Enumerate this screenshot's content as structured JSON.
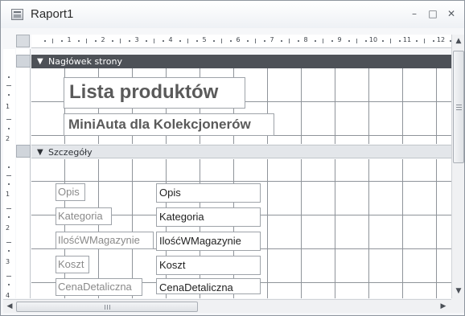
{
  "window": {
    "title": "Raport1",
    "icon": "report-icon",
    "controls": [
      "minimize-icon",
      "restore-icon",
      "close-icon"
    ]
  },
  "ruler": {
    "numbers": [
      "1",
      "2",
      "3",
      "4",
      "5",
      "6",
      "7",
      "8",
      "9",
      "10",
      "11",
      "12"
    ],
    "vertical_numbers": [
      "1",
      "2",
      "1",
      "2",
      "3",
      "4"
    ]
  },
  "sections": {
    "page_header": "Nagłówek strony",
    "detail": "Szczegóły"
  },
  "page_header": {
    "title": "Lista produktów",
    "subtitle": "MiniAuta dla Kolekcjonerów"
  },
  "detail": {
    "fields": [
      {
        "label": "Opis",
        "control": "Opis"
      },
      {
        "label": "Kategoria",
        "control": "Kategoria"
      },
      {
        "label": "IlośćWMagazynie",
        "control": "IlośćWMagazynie"
      },
      {
        "label": "Koszt",
        "control": "Koszt"
      },
      {
        "label": "CenaDetaliczna",
        "control": "CenaDetaliczna"
      }
    ]
  },
  "colors": {
    "section_header_dark": "#4d5157",
    "section_header_light": "#e3e6ea",
    "grid_line": "#8f949a"
  }
}
